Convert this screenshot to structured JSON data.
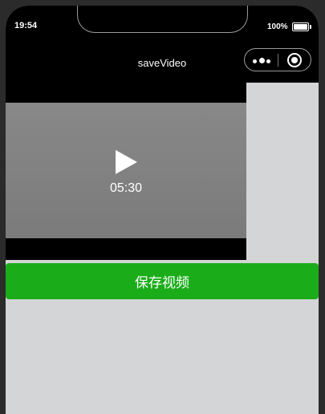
{
  "status_bar": {
    "time": "19:54",
    "battery_percent": "100%"
  },
  "nav_bar": {
    "title": "saveVideo",
    "menu_icon": "more-dots-icon",
    "close_icon": "target-icon"
  },
  "video": {
    "duration": "05:30",
    "play_icon": "play-icon"
  },
  "actions": {
    "save_label": "保存视频",
    "save_color": "#1aad19"
  },
  "colors": {
    "nav_background": "#000000",
    "page_background": "#d4d5d6"
  }
}
